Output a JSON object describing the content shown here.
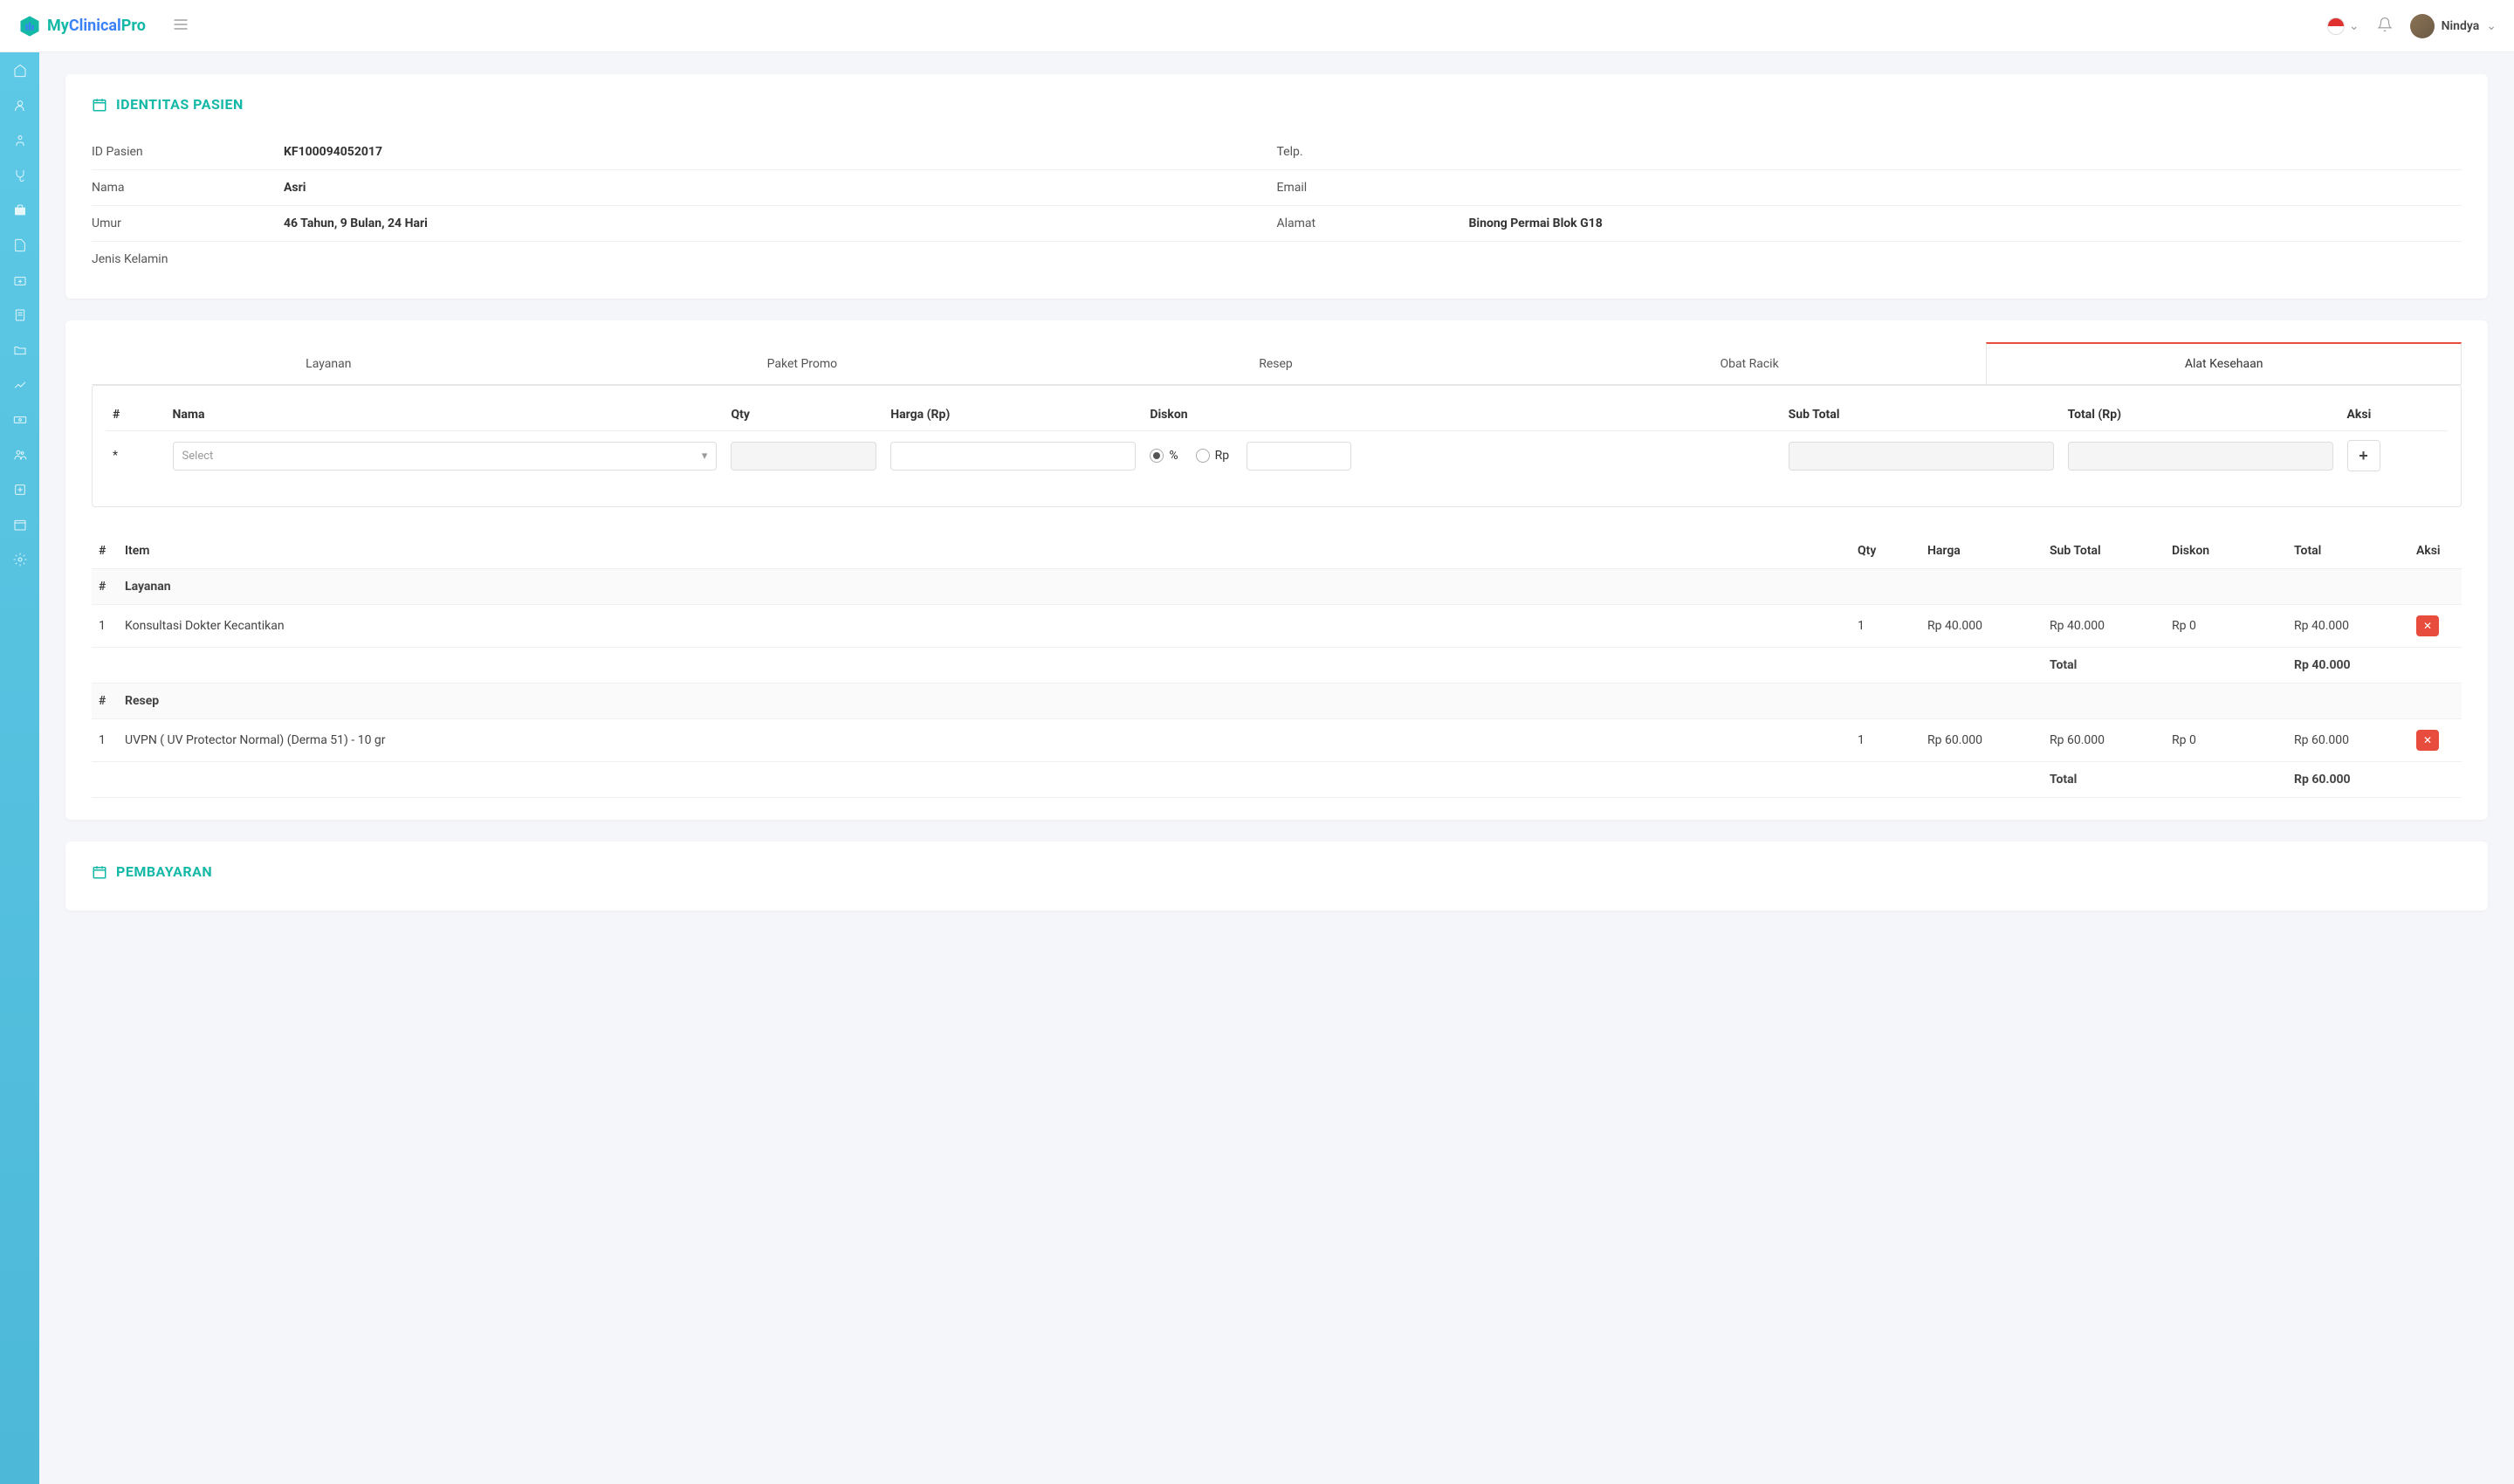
{
  "brand": {
    "my": "My",
    "clinical": "Clinical",
    "pro": "Pro"
  },
  "user": {
    "name": "Nindya"
  },
  "patientSection": {
    "title": "IDENTITAS PASIEN",
    "labels": {
      "id": "ID Pasien",
      "name": "Nama",
      "age": "Umur",
      "gender": "Jenis Kelamin",
      "phone": "Telp.",
      "email": "Email",
      "address": "Alamat"
    },
    "values": {
      "id": "KF100094052017",
      "name": "Asri",
      "age": "46 Tahun, 9 Bulan, 24 Hari",
      "gender": "",
      "phone": "",
      "email": "",
      "address": "Binong Permai Blok G18"
    }
  },
  "tabs": [
    "Layanan",
    "Paket Promo",
    "Resep",
    "Obat Racik",
    "Alat Kesehaan"
  ],
  "activeTab": 4,
  "entryHeaders": {
    "num": "#",
    "nama": "Nama",
    "qty": "Qty",
    "harga": "Harga (Rp)",
    "diskon": "Diskon",
    "subtotal": "Sub Total",
    "total": "Total (Rp)",
    "aksi": "Aksi"
  },
  "entryRow": {
    "star": "*",
    "selectPlaceholder": "Select",
    "percent": "%",
    "rp": "Rp"
  },
  "summaryHeaders": {
    "num": "#",
    "item": "Item",
    "qty": "Qty",
    "harga": "Harga",
    "subtotal": "Sub Total",
    "diskon": "Diskon",
    "total": "Total",
    "aksi": "Aksi"
  },
  "sections": [
    {
      "title": "Layanan",
      "rows": [
        {
          "num": "1",
          "item": "Konsultasi Dokter Kecantikan",
          "qty": "1",
          "harga": "Rp 40.000",
          "subtotal": "Rp 40.000",
          "diskon": "Rp 0",
          "total": "Rp 40.000"
        }
      ],
      "totalLabel": "Total",
      "totalValue": "Rp 40.000"
    },
    {
      "title": "Resep",
      "rows": [
        {
          "num": "1",
          "item": "UVPN ( UV Protector Normal) (Derma 51) - 10 gr",
          "qty": "1",
          "harga": "Rp 60.000",
          "subtotal": "Rp 60.000",
          "diskon": "Rp 0",
          "total": "Rp 60.000"
        }
      ],
      "totalLabel": "Total",
      "totalValue": "Rp 60.000"
    }
  ],
  "paymentTitle": "PEMBAYARAN"
}
